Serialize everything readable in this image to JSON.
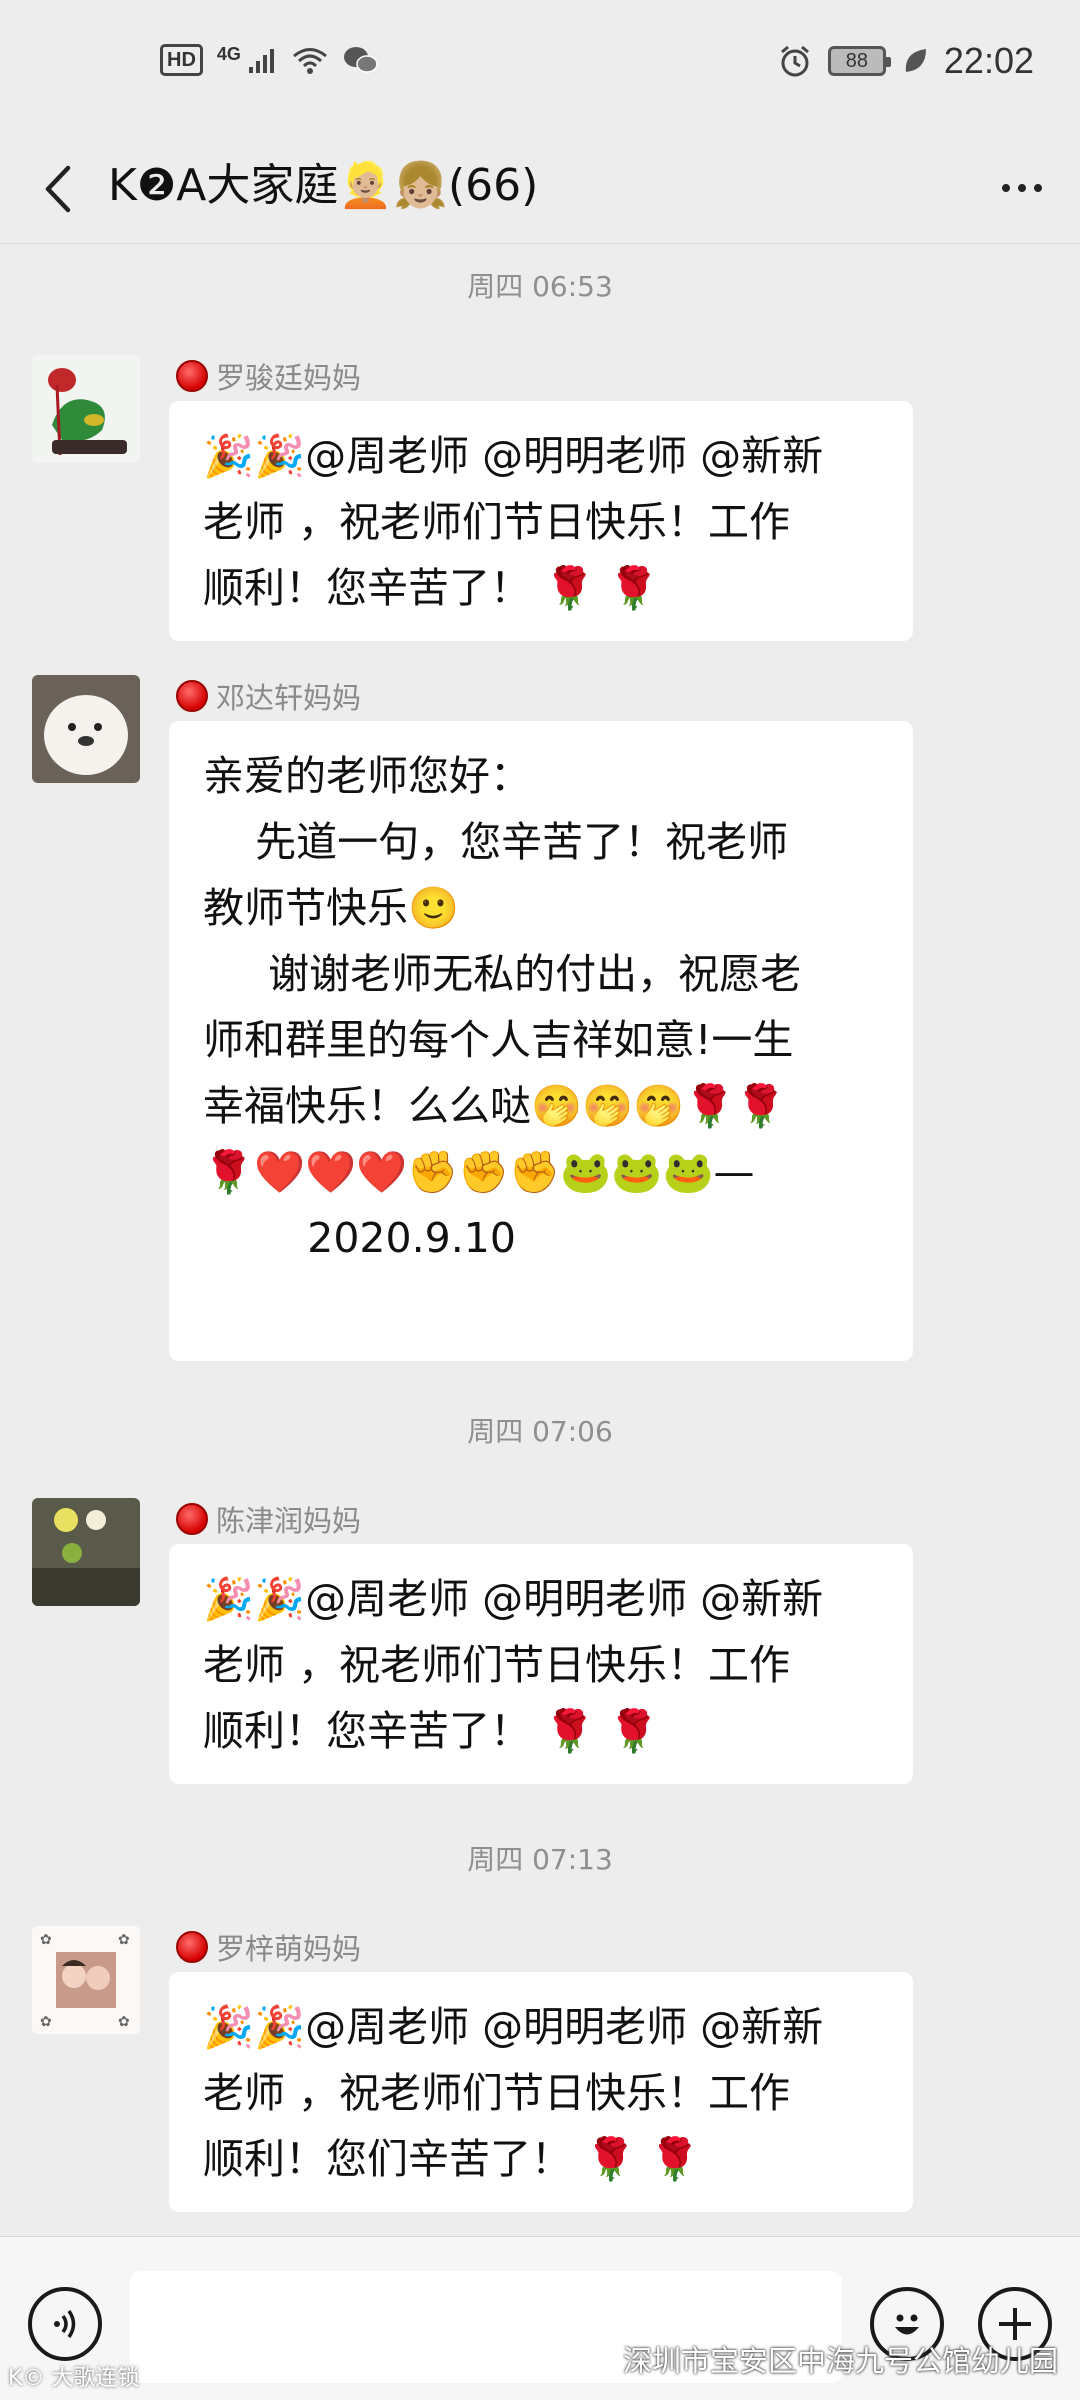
{
  "status_bar": {
    "hd": "HD",
    "network": "4G",
    "battery": "88",
    "time": "22:02"
  },
  "header": {
    "title": "K❷A大家庭👱🏼👧🏼(66)"
  },
  "messages": [
    {
      "timestamp": "周四 06:53",
      "sender": "罗骏廷妈妈",
      "lines": [
        "🎉🎉@周老师 @明明老师 @新新",
        "老师 ，祝老师们节日快乐！工作",
        "顺利！您辛苦了！ 🌹 🌹"
      ]
    },
    {
      "timestamp": "",
      "sender": "邓达轩妈妈",
      "lines": [
        "亲爱的老师您好：",
        "    先道一句，您辛苦了！祝老师",
        "教师节快乐🙂",
        "     谢谢老师无私的付出，祝愿老",
        "师和群里的每个人吉祥如意!一生",
        "幸福快乐！么么哒🤭🤭🤭🌹🌹",
        "🌹❤️❤️❤️✊✊✊🐸🐸🐸—",
        "",
        "        2020.9.10"
      ]
    },
    {
      "timestamp": "周四 07:06",
      "sender": "陈津润妈妈",
      "lines": [
        "🎉🎉@周老师 @明明老师 @新新",
        "老师 ，祝老师们节日快乐！工作",
        "顺利！您辛苦了！ 🌹 🌹"
      ]
    },
    {
      "timestamp": "周四 07:13",
      "sender": "罗梓萌妈妈",
      "lines": [
        "🎉🎉@周老师 @明明老师 @新新",
        "老师 ，祝老师们节日快乐！工作",
        "顺利！您们辛苦了！ 🌹 🌹"
      ]
    }
  ],
  "input_bar": {
    "message_value": ""
  },
  "watermark": {
    "left": "K© 大歌连锁",
    "right": "深圳市宝安区中海九号公馆幼儿园"
  },
  "icons": {
    "back": "chevron-left-icon",
    "more": "more-horizontal-icon",
    "voice": "voice-icon",
    "emoji": "emoji-icon",
    "plus": "plus-icon"
  }
}
